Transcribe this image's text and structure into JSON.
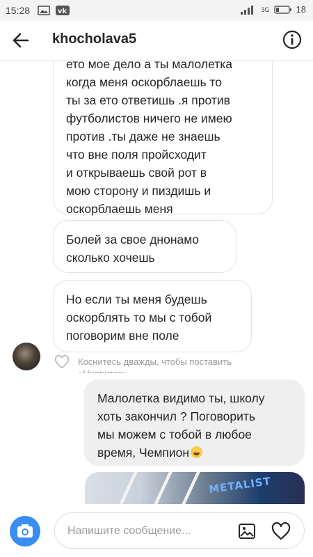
{
  "status_bar": {
    "time": "15:28",
    "network": "3G",
    "battery": "18",
    "icons": [
      "image-icon",
      "vk-icon",
      "signal-icon",
      "battery-icon"
    ]
  },
  "header": {
    "username": "khocholava5",
    "icons": [
      "back-arrow-icon",
      "info-icon"
    ]
  },
  "messages": {
    "incoming": [
      {
        "lines": [
          "ето мое дело а ты малолетка",
          "когда меня оскорблаешь то",
          "ты за ето ответишь .я против",
          "футболистов ничего не имею",
          "против .ты даже не знаешь",
          "что вне поля пройсходит",
          "и открываешь свой рот в",
          "мою сторону и пиздишь и",
          "оскорблаешь меня"
        ]
      },
      {
        "lines": [
          "Болей за свое днонамо",
          "сколько хочешь"
        ]
      },
      {
        "lines": [
          "Но если ты меня будешь",
          "оскорблять то мы с тобой",
          "поговорим вне поле"
        ]
      }
    ],
    "like_hint": {
      "lines": [
        "Коснитесь дважды, чтобы поставить",
        "«Нравится»"
      ]
    },
    "outgoing": {
      "lines": [
        "Малолетка видимо ты, школу",
        "хоть закончил ? Поговорить",
        "мы можем с тобой в любое",
        "время, Чемпион"
      ],
      "emoji": "laughing-crying-emoji"
    },
    "photo": {
      "sign_text": "METALIST"
    }
  },
  "composer": {
    "placeholder": "Напишите сообщение...",
    "value": "",
    "icons": [
      "camera-icon",
      "gallery-icon",
      "heart-icon"
    ]
  },
  "colors": {
    "camera_button": "#3a8df2",
    "outgoing_bubble": "#efefef",
    "incoming_border": "#e3e3e3"
  }
}
